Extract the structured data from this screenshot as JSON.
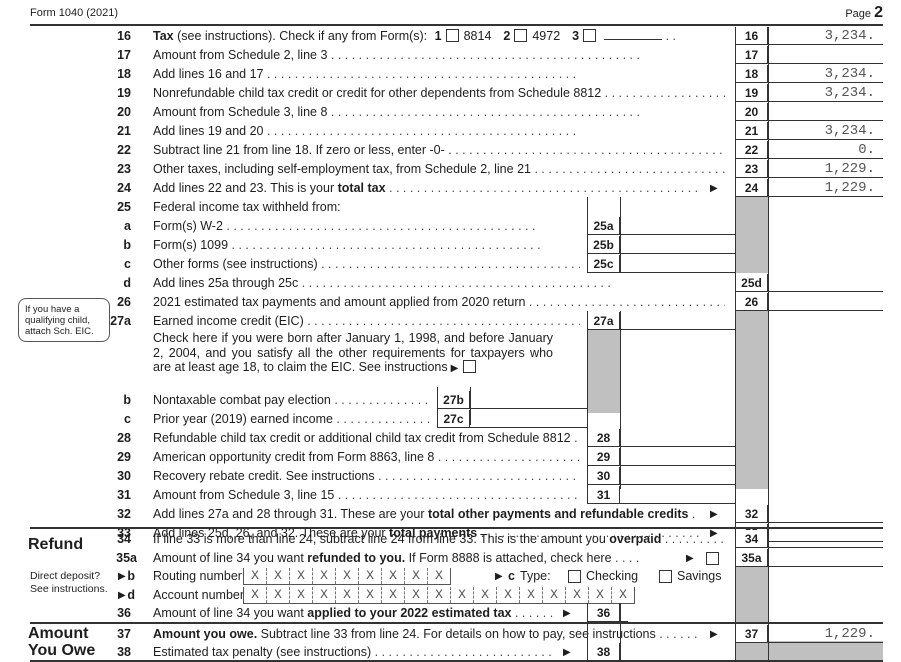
{
  "header": {
    "form_label": "Form 1040 (2021)",
    "page_label": "Page",
    "page_number": "2"
  },
  "lines": {
    "l16": {
      "num": "16",
      "bold_prefix": "Tax",
      "text": " (see instructions). Check if any from Form(s): ",
      "cb1_num": "1",
      "cb1_label": "8814",
      "cb2_num": "2",
      "cb2_label": "4972",
      "cb3_num": "3",
      "box": "16",
      "value": "3,234."
    },
    "l17": {
      "num": "17",
      "text": "Amount from Schedule 2, line 3",
      "box": "17",
      "value": ""
    },
    "l18": {
      "num": "18",
      "text": "Add lines 16 and 17",
      "box": "18",
      "value": "3,234."
    },
    "l19": {
      "num": "19",
      "text": "Nonrefundable child tax credit or credit for other dependents from Schedule 8812",
      "box": "19",
      "value": "3,234."
    },
    "l20": {
      "num": "20",
      "text": "Amount from Schedule 3, line 8",
      "box": "20",
      "value": ""
    },
    "l21": {
      "num": "21",
      "text": "Add lines 19 and 20",
      "box": "21",
      "value": "3,234."
    },
    "l22": {
      "num": "22",
      "text": "Subtract line 21 from line 18. If zero or less, enter -0-",
      "box": "22",
      "value": "0."
    },
    "l23": {
      "num": "23",
      "text": "Other taxes, including self-employment tax, from Schedule 2, line 21",
      "box": "23",
      "value": "1,229."
    },
    "l24": {
      "num": "24",
      "text": "Add lines 22 and 23. This is your ",
      "bold": "total tax",
      "box": "24",
      "value": "1,229."
    },
    "l25": {
      "num": "25",
      "text": "Federal income tax withheld from:"
    },
    "l25a": {
      "num": "a",
      "text": "Form(s) W-2",
      "box": "25a",
      "value": ""
    },
    "l25b": {
      "num": "b",
      "text": "Form(s) 1099",
      "box": "25b",
      "value": ""
    },
    "l25c": {
      "num": "c",
      "text": "Other forms (see instructions)",
      "box": "25c",
      "value": ""
    },
    "l25d": {
      "num": "d",
      "text": "Add lines 25a through 25c",
      "box": "25d",
      "value": ""
    },
    "l26": {
      "num": "26",
      "text": "2021 estimated tax payments and amount applied from 2020 return",
      "box": "26",
      "value": ""
    },
    "l27a": {
      "num": "27a",
      "text": "Earned income credit (EIC)",
      "box": "27a",
      "value": ""
    },
    "l27_check": {
      "text": "Check here if you were born after January 1, 1998, and before January 2, 2004, and you satisfy all the other requirements for taxpayers who are at least age 18, to claim the EIC. See instructions"
    },
    "l27b": {
      "num": "b",
      "text": "Nontaxable combat pay election",
      "box": "27b",
      "value": ""
    },
    "l27c": {
      "num": "c",
      "text": "Prior year (2019) earned income",
      "box": "27c",
      "value": ""
    },
    "l28": {
      "num": "28",
      "text": "Refundable child tax credit or additional child tax credit from Schedule 8812",
      "box": "28",
      "value": ""
    },
    "l29": {
      "num": "29",
      "text": "American opportunity credit from Form 8863, line 8",
      "box": "29",
      "value": ""
    },
    "l30": {
      "num": "30",
      "text": "Recovery rebate credit. See instructions",
      "box": "30",
      "value": ""
    },
    "l31": {
      "num": "31",
      "text": "Amount from Schedule 3, line 15",
      "box": "31",
      "value": ""
    },
    "l32": {
      "num": "32",
      "text": "Add lines 27a and 28 through 31. These are your ",
      "bold": "total other payments and refundable credits",
      "box": "32",
      "value": ""
    },
    "l33": {
      "num": "33",
      "text": "Add lines 25d, 26, and 32. These are your ",
      "bold": "total payments",
      "box": "33",
      "value": ""
    },
    "l34": {
      "num": "34",
      "text": "If line 33 is more than line 24, subtract line 24 from line 33. This is the amount you ",
      "bold": "overpaid",
      "box": "34",
      "value": ""
    },
    "l35a": {
      "num": "35a",
      "text": "Amount of line 34 you want ",
      "bold": "refunded to you.",
      "text2": " If Form 8888 is attached, check here",
      "box": "35a",
      "value": ""
    },
    "l35b": {
      "num": "b",
      "text": "Routing number",
      "digits": [
        "X",
        "X",
        "X",
        "X",
        "X",
        "X",
        "X",
        "X",
        "X"
      ],
      "type_label": "Type:",
      "c_label": "c",
      "checking": "Checking",
      "savings": "Savings"
    },
    "l35d": {
      "num": "d",
      "text": "Account number",
      "digits": [
        "X",
        "X",
        "X",
        "X",
        "X",
        "X",
        "X",
        "X",
        "X",
        "X",
        "X",
        "X",
        "X",
        "X",
        "X",
        "X",
        "X"
      ]
    },
    "l36": {
      "num": "36",
      "text": "Amount of line 34 you want ",
      "bold": "applied to your 2022 estimated tax",
      "box": "36",
      "value": ""
    },
    "l37": {
      "num": "37",
      "bold": "Amount you owe.",
      "text": " Subtract line 33 from line 24. For details on how to pay, see instructions",
      "box": "37",
      "value": "1,229."
    },
    "l38": {
      "num": "38",
      "text": "Estimated tax penalty (see instructions)",
      "box": "38",
      "value": ""
    }
  },
  "sidebar": {
    "eic_note": [
      "If you have a",
      "qualifying child,",
      "attach Sch. EIC."
    ],
    "refund_title": "Refund",
    "direct_deposit": [
      "Direct deposit?",
      "See instructions."
    ],
    "amount_owe_title": [
      "Amount",
      "You Owe"
    ]
  },
  "icons": {
    "arrow": "▶",
    "checkbox": "checkbox"
  }
}
